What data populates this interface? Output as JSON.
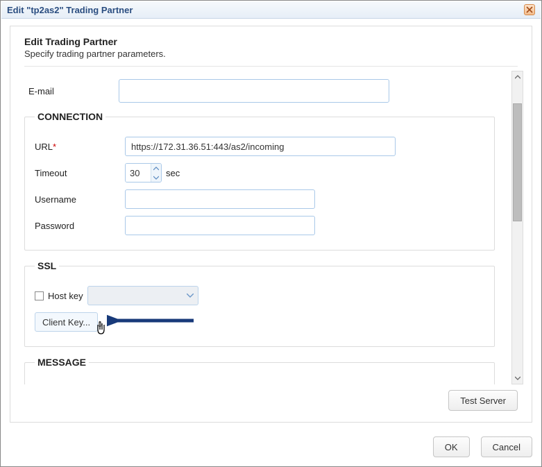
{
  "dialog": {
    "title": "Edit \"tp2as2\" Trading Partner"
  },
  "panel": {
    "title": "Edit Trading Partner",
    "subtitle": "Specify trading partner parameters."
  },
  "form": {
    "email_label": "E-mail",
    "email_value": ""
  },
  "connection": {
    "legend": "CONNECTION",
    "url_label": "URL",
    "url_required": "*",
    "url_value": "https://172.31.36.51:443/as2/incoming",
    "timeout_label": "Timeout",
    "timeout_value": "30",
    "timeout_unit": "sec",
    "username_label": "Username",
    "username_value": "",
    "password_label": "Password",
    "password_value": ""
  },
  "ssl": {
    "legend": "SSL",
    "hostkey_label": "Host key",
    "hostkey_checked": false,
    "hostkey_selected": "",
    "clientkey_label": "Client Key..."
  },
  "message": {
    "legend": "MESSAGE"
  },
  "actions": {
    "test_server": "Test Server",
    "ok": "OK",
    "cancel": "Cancel"
  },
  "colors": {
    "accent": "#2a4d80",
    "arrow": "#183a7a",
    "field_border": "#a9c8e8"
  }
}
